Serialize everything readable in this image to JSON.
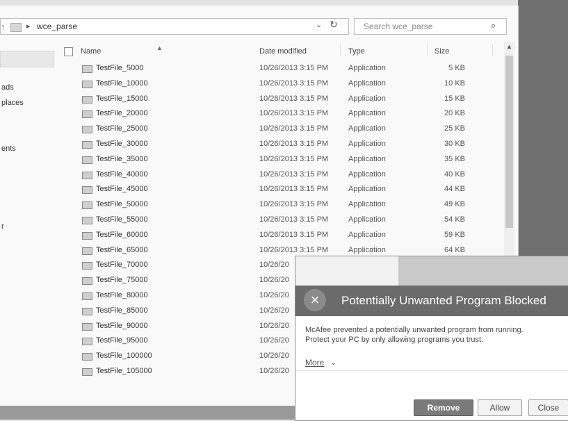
{
  "address": {
    "path_label": "wce_parse"
  },
  "search": {
    "placeholder": "Search wce_parse"
  },
  "nav_pane": {
    "items": [
      "ads",
      "places",
      "ents",
      "r"
    ]
  },
  "columns": {
    "name": "Name",
    "date_modified": "Date modified",
    "type": "Type",
    "size": "Size"
  },
  "files": [
    {
      "name": "TestFile_5000",
      "date": "10/26/2013 3:15 PM",
      "type": "Application",
      "size": "5 KB"
    },
    {
      "name": "TestFile_10000",
      "date": "10/26/2013 3:15 PM",
      "type": "Application",
      "size": "10 KB"
    },
    {
      "name": "TestFile_15000",
      "date": "10/26/2013 3:15 PM",
      "type": "Application",
      "size": "15 KB"
    },
    {
      "name": "TestFile_20000",
      "date": "10/26/2013 3:15 PM",
      "type": "Application",
      "size": "20 KB"
    },
    {
      "name": "TestFile_25000",
      "date": "10/26/2013 3:15 PM",
      "type": "Application",
      "size": "25 KB"
    },
    {
      "name": "TestFile_30000",
      "date": "10/26/2013 3:15 PM",
      "type": "Application",
      "size": "30 KB"
    },
    {
      "name": "TestFile_35000",
      "date": "10/26/2013 3:15 PM",
      "type": "Application",
      "size": "35 KB"
    },
    {
      "name": "TestFile_40000",
      "date": "10/26/2013 3:15 PM",
      "type": "Application",
      "size": "40 KB"
    },
    {
      "name": "TestFile_45000",
      "date": "10/26/2013 3:15 PM",
      "type": "Application",
      "size": "44 KB"
    },
    {
      "name": "TestFile_50000",
      "date": "10/26/2013 3:15 PM",
      "type": "Application",
      "size": "49 KB"
    },
    {
      "name": "TestFile_55000",
      "date": "10/26/2013 3:15 PM",
      "type": "Application",
      "size": "54 KB"
    },
    {
      "name": "TestFile_60000",
      "date": "10/26/2013 3:15 PM",
      "type": "Application",
      "size": "59 KB"
    },
    {
      "name": "TestFile_65000",
      "date": "10/26/2013 3:15 PM",
      "type": "Application",
      "size": "64 KB"
    },
    {
      "name": "TestFile_70000",
      "date": "10/26/20",
      "type": "",
      "size": ""
    },
    {
      "name": "TestFile_75000",
      "date": "10/26/20",
      "type": "",
      "size": ""
    },
    {
      "name": "TestFile_80000",
      "date": "10/26/20",
      "type": "",
      "size": ""
    },
    {
      "name": "TestFile_85000",
      "date": "10/26/20",
      "type": "",
      "size": ""
    },
    {
      "name": "TestFile_90000",
      "date": "10/26/20",
      "type": "",
      "size": ""
    },
    {
      "name": "TestFile_95000",
      "date": "10/26/20",
      "type": "",
      "size": ""
    },
    {
      "name": "TestFile_100000",
      "date": "10/26/20",
      "type": "",
      "size": ""
    },
    {
      "name": "TestFile_105000",
      "date": "10/26/20",
      "type": "",
      "size": ""
    }
  ],
  "popup": {
    "title": "Potentially Unwanted Program Blocked",
    "message_line1": "McAfee prevented a potentially unwanted program from running.",
    "message_line2": "Protect your PC by only allowing programs you trust.",
    "more_label": "More",
    "buttons": {
      "remove": "Remove",
      "allow": "Allow",
      "close": "Close"
    }
  },
  "icons": {
    "up": "up-arrow-icon",
    "folder": "folder-icon",
    "breadcrumb_separator": "chevron-right-icon",
    "dropdown": "chevron-down-icon",
    "refresh": "refresh-icon",
    "search": "search-icon",
    "file": "application-file-icon",
    "sort": "sort-ascending-icon",
    "close": "close-icon"
  },
  "colors": {
    "popup_title_band": "#6b6b6b",
    "remove_button": "#7a7a7a",
    "window_bg": "#f9f9f9"
  }
}
